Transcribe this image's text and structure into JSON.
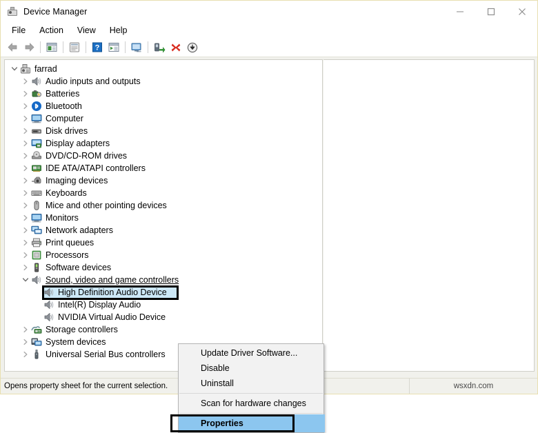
{
  "window": {
    "title": "Device Manager",
    "icon": "device-manager-icon",
    "controls": [
      {
        "name": "minimize-button",
        "glyph": "minimize-icon"
      },
      {
        "name": "maximize-button",
        "glyph": "maximize-icon"
      },
      {
        "name": "close-button",
        "glyph": "close-icon"
      }
    ]
  },
  "menubar": {
    "items": [
      {
        "label": "File",
        "name": "menu-file"
      },
      {
        "label": "Action",
        "name": "menu-action"
      },
      {
        "label": "View",
        "name": "menu-view"
      },
      {
        "label": "Help",
        "name": "menu-help"
      }
    ]
  },
  "toolbar": {
    "buttons": [
      {
        "name": "back-icon",
        "title": "Back"
      },
      {
        "name": "forward-icon",
        "title": "Forward"
      },
      {
        "name": "show-hide-console-tree-icon",
        "title": "Show/Hide Console Tree"
      },
      {
        "name": "properties-icon",
        "title": "Properties"
      },
      {
        "name": "help-icon",
        "title": "Help"
      },
      {
        "name": "scan-for-hardware-changes-icon",
        "title": "Scan for hardware changes"
      },
      {
        "name": "update-driver-software-icon",
        "title": "Update Driver Software"
      },
      {
        "name": "uninstall-device-icon",
        "title": "Uninstall"
      },
      {
        "name": "disable-device-icon",
        "title": "Disable"
      },
      {
        "name": "enable-device-icon",
        "title": "Enable"
      }
    ]
  },
  "tree": {
    "root": {
      "label": "farrad",
      "icon": "computer-tower-icon",
      "expanded": true
    },
    "categories": [
      {
        "label": "Audio inputs and outputs",
        "icon": "speaker-icon",
        "expanded": false
      },
      {
        "label": "Batteries",
        "icon": "battery-icon",
        "expanded": false
      },
      {
        "label": "Bluetooth",
        "icon": "bluetooth-icon",
        "expanded": false
      },
      {
        "label": "Computer",
        "icon": "monitor-icon",
        "expanded": false
      },
      {
        "label": "Disk drives",
        "icon": "disk-drive-icon",
        "expanded": false
      },
      {
        "label": "Display adapters",
        "icon": "display-adapter-icon",
        "expanded": false
      },
      {
        "label": "DVD/CD-ROM drives",
        "icon": "optical-drive-icon",
        "expanded": false
      },
      {
        "label": "IDE ATA/ATAPI controllers",
        "icon": "controller-card-icon",
        "expanded": false
      },
      {
        "label": "Imaging devices",
        "icon": "camera-icon",
        "expanded": false
      },
      {
        "label": "Keyboards",
        "icon": "keyboard-icon",
        "expanded": false
      },
      {
        "label": "Mice and other pointing devices",
        "icon": "mouse-icon",
        "expanded": false
      },
      {
        "label": "Monitors",
        "icon": "monitor-icon",
        "expanded": false
      },
      {
        "label": "Network adapters",
        "icon": "network-adapter-icon",
        "expanded": false
      },
      {
        "label": "Print queues",
        "icon": "printer-icon",
        "expanded": false
      },
      {
        "label": "Processors",
        "icon": "processor-icon",
        "expanded": false
      },
      {
        "label": "Software devices",
        "icon": "software-device-icon",
        "expanded": false
      },
      {
        "label": "Sound, video and game controllers",
        "icon": "speaker-icon",
        "expanded": true,
        "underline": true
      },
      {
        "label": "Storage controllers",
        "icon": "storage-controller-icon",
        "expanded": false
      },
      {
        "label": "System devices",
        "icon": "system-device-icon",
        "expanded": false
      },
      {
        "label": "Universal Serial Bus controllers",
        "icon": "usb-icon",
        "expanded": false
      }
    ],
    "sound_children": [
      {
        "label": "High Definition Audio Device",
        "icon": "speaker-icon",
        "selected": true,
        "annotated": true
      },
      {
        "label": "Intel(R) Display Audio",
        "icon": "speaker-icon",
        "selected": false,
        "annotated": false
      },
      {
        "label": "NVIDIA Virtual Audio Device",
        "icon": "speaker-icon",
        "selected": false,
        "annotated": false
      }
    ]
  },
  "context_menu": {
    "items": [
      {
        "label": "Update Driver Software...",
        "name": "ctx-update-driver-software",
        "highlight": false,
        "separator_after": false
      },
      {
        "label": "Disable",
        "name": "ctx-disable",
        "highlight": false,
        "separator_after": false
      },
      {
        "label": "Uninstall",
        "name": "ctx-uninstall",
        "highlight": false,
        "separator_after": true
      },
      {
        "label": "Scan for hardware changes",
        "name": "ctx-scan-for-hardware-changes",
        "highlight": false,
        "separator_after": true
      },
      {
        "label": "Properties",
        "name": "ctx-properties",
        "highlight": true,
        "separator_after": false
      }
    ]
  },
  "statusbar": {
    "message": "Opens property sheet for the current selection.",
    "middle": "",
    "watermark": "wsxdn.com"
  },
  "colors": {
    "selection_blue": "#cde8f7",
    "menu_highlight": "#8cc6ef",
    "annotation_black": "#000000",
    "window_border": "#e8dfb0",
    "panel_bg": "#f1f1ec"
  }
}
